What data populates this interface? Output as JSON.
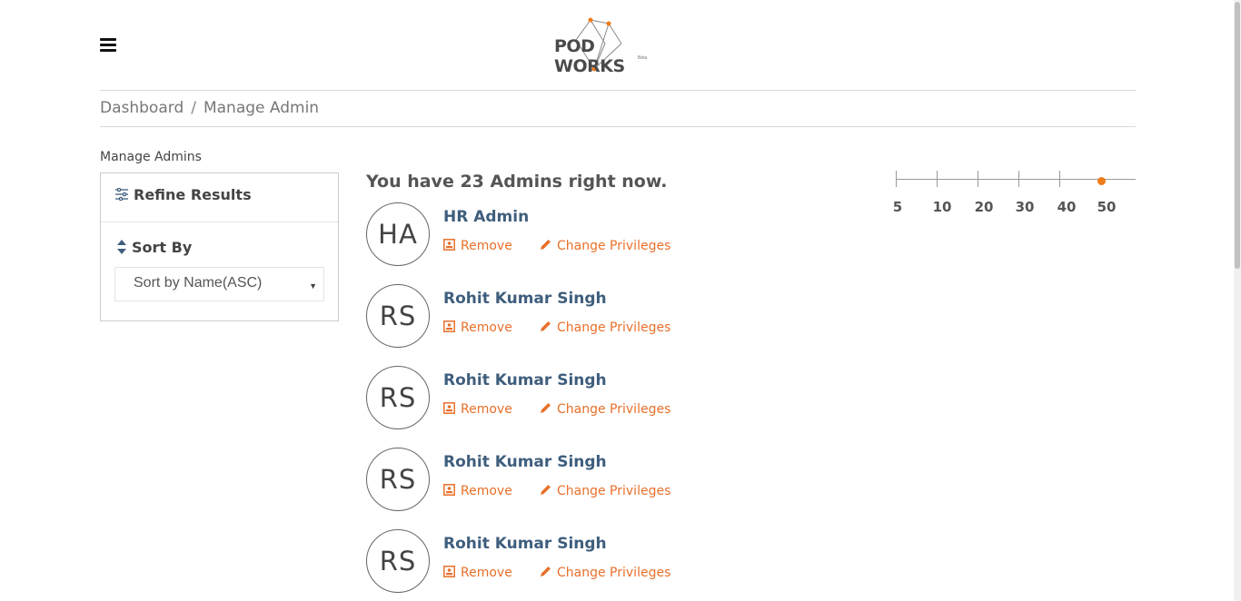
{
  "header": {
    "menu_icon": "hamburger-icon",
    "logo_text": "POD WORKS",
    "logo_badge": "Beta"
  },
  "breadcrumb": {
    "items": [
      "Dashboard",
      "Manage Admin"
    ],
    "separator": "/"
  },
  "sidebar": {
    "section_label": "Manage Admins",
    "refine_title": "Refine Results",
    "refine_icon": "sliders-icon",
    "sort_label": "Sort By",
    "sort_icon": "sort-icon",
    "sort_selected": "Sort by Name(ASC)"
  },
  "main": {
    "count_title": "You have 23 Admins right now.",
    "remove_label": "Remove",
    "privileges_label": "Change Privileges",
    "admins": [
      {
        "initials": "HA",
        "name": "HR Admin"
      },
      {
        "initials": "RS",
        "name": "Rohit Kumar Singh"
      },
      {
        "initials": "RS",
        "name": "Rohit Kumar Singh"
      },
      {
        "initials": "RS",
        "name": "Rohit Kumar Singh"
      },
      {
        "initials": "RS",
        "name": "Rohit Kumar Singh"
      }
    ]
  },
  "page_size_slider": {
    "options": [
      "5",
      "10",
      "20",
      "30",
      "40",
      "50"
    ],
    "selected": "50"
  },
  "colors": {
    "accent": "#e8702a",
    "knob": "#f07c1a",
    "name": "#3f5e7d",
    "text": "#555555"
  }
}
